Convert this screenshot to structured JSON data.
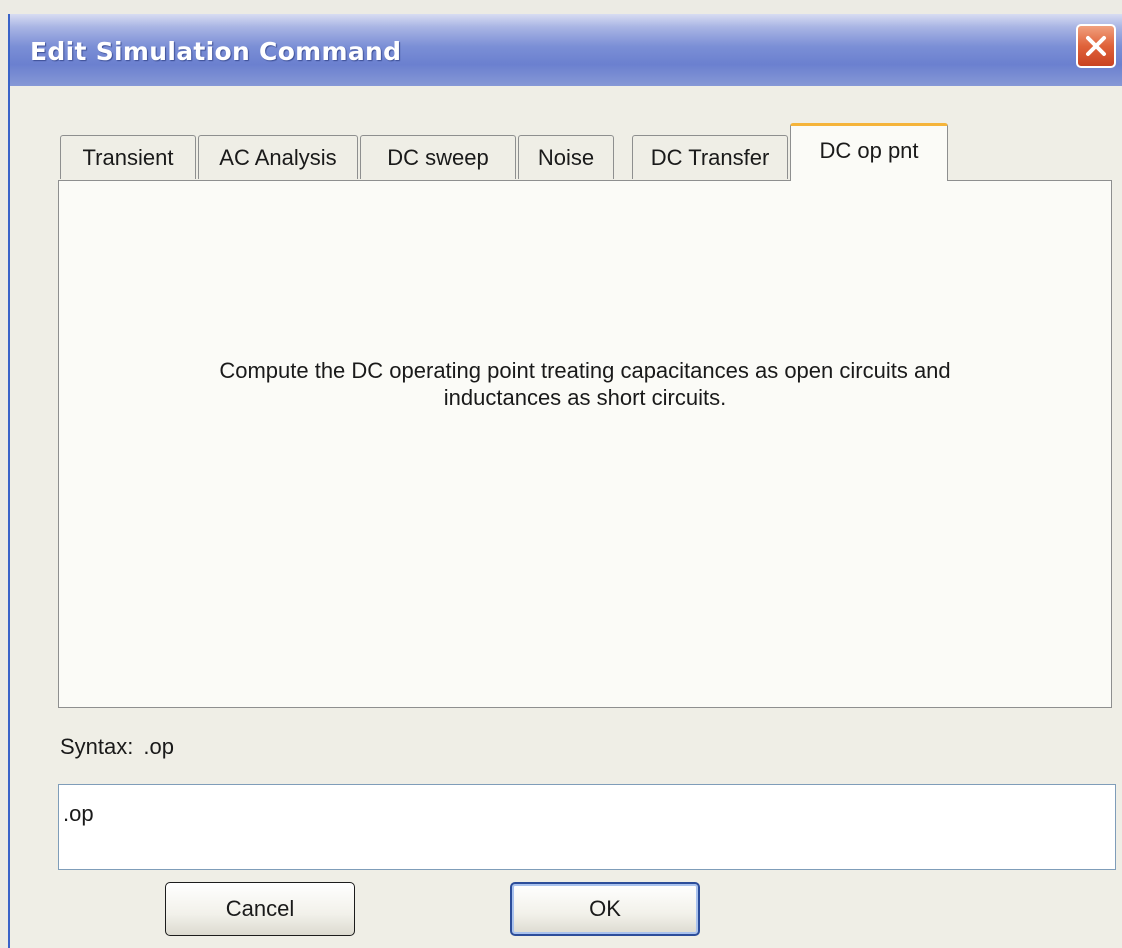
{
  "window": {
    "title": "Edit Simulation Command",
    "title_bar_color": "#7b8fd6",
    "close_button_color": "#e0623a"
  },
  "tabs": [
    {
      "label": "Transient",
      "selected": false
    },
    {
      "label": "AC Analysis",
      "selected": false
    },
    {
      "label": "DC sweep",
      "selected": false
    },
    {
      "label": "Noise",
      "selected": false
    },
    {
      "label": "DC Transfer",
      "selected": false
    },
    {
      "label": "DC op pnt",
      "selected": true
    }
  ],
  "active_tab_accent": "#f5b43a",
  "panel": {
    "description_line1": "Compute the DC operating point treating capacitances as open circuits and",
    "description_line2": "inductances as short circuits."
  },
  "syntax": {
    "label": "Syntax:",
    "value": ".op"
  },
  "command": {
    "value": ".op"
  },
  "buttons": {
    "cancel": "Cancel",
    "ok": "OK"
  }
}
